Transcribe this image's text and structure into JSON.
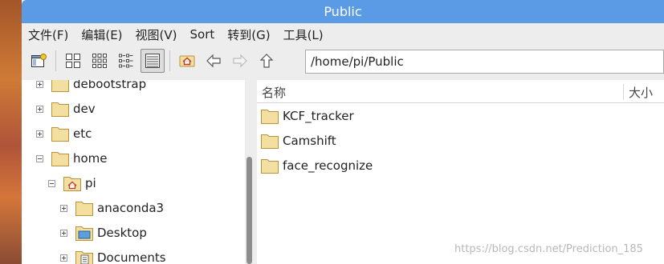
{
  "window": {
    "title": "Public"
  },
  "menu": [
    {
      "label": "文件(F)"
    },
    {
      "label": "编辑(E)"
    },
    {
      "label": "视图(V)"
    },
    {
      "label": "Sort"
    },
    {
      "label": "转到(G)"
    },
    {
      "label": "工具(L)"
    }
  ],
  "toolbar": {
    "path_value": "/home/pi/Public",
    "active_view": "detailed-list-view",
    "colors": {
      "accent": "#5b9be6",
      "folder": "#f3dfa0",
      "folder_border": "#b9923e"
    }
  },
  "tree": [
    {
      "label": "debootstrap",
      "expander": "plus",
      "icon": "folder-icon"
    },
    {
      "label": "dev",
      "expander": "plus",
      "icon": "folder-icon"
    },
    {
      "label": "etc",
      "expander": "plus",
      "icon": "folder-icon"
    },
    {
      "label": "home",
      "expander": "minus",
      "icon": "folder-icon"
    },
    {
      "label": "pi",
      "expander": "minus",
      "icon": "home-folder-icon"
    },
    {
      "label": "anaconda3",
      "expander": "plus",
      "icon": "folder-icon"
    },
    {
      "label": "Desktop",
      "expander": "plus",
      "icon": "desktop-folder-icon"
    },
    {
      "label": "Documents",
      "expander": "plus",
      "icon": "documents-folder-icon"
    }
  ],
  "file_list": {
    "columns": {
      "name": "名称",
      "size": "大小"
    },
    "items": [
      {
        "name": "KCF_tracker"
      },
      {
        "name": "Camshift"
      },
      {
        "name": "face_recognize"
      }
    ]
  },
  "watermark": "https://blog.csdn.net/Prediction_185"
}
